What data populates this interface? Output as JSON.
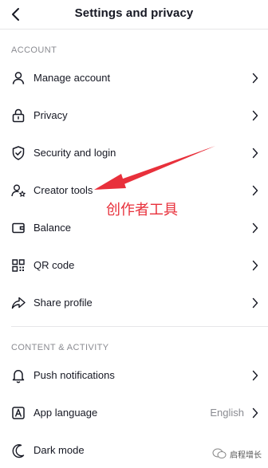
{
  "header": {
    "title": "Settings and privacy"
  },
  "sections": {
    "account": "ACCOUNT",
    "content": "CONTENT & ACTIVITY"
  },
  "account_items": [
    {
      "label": "Manage account",
      "icon": "person-icon"
    },
    {
      "label": "Privacy",
      "icon": "lock-icon"
    },
    {
      "label": "Security and login",
      "icon": "shield-icon"
    },
    {
      "label": "Creator tools",
      "icon": "person-star-icon"
    },
    {
      "label": "Balance",
      "icon": "wallet-icon"
    },
    {
      "label": "QR code",
      "icon": "qr-code-icon"
    },
    {
      "label": "Share profile",
      "icon": "share-icon"
    }
  ],
  "content_items": [
    {
      "label": "Push notifications",
      "icon": "bell-icon"
    },
    {
      "label": "App language",
      "icon": "language-icon",
      "value": "English"
    },
    {
      "label": "Dark mode",
      "icon": "moon-icon"
    }
  ],
  "annotation": {
    "text": "创作者工具",
    "color": "#e8303b"
  },
  "watermark": {
    "text": "启程增长"
  }
}
